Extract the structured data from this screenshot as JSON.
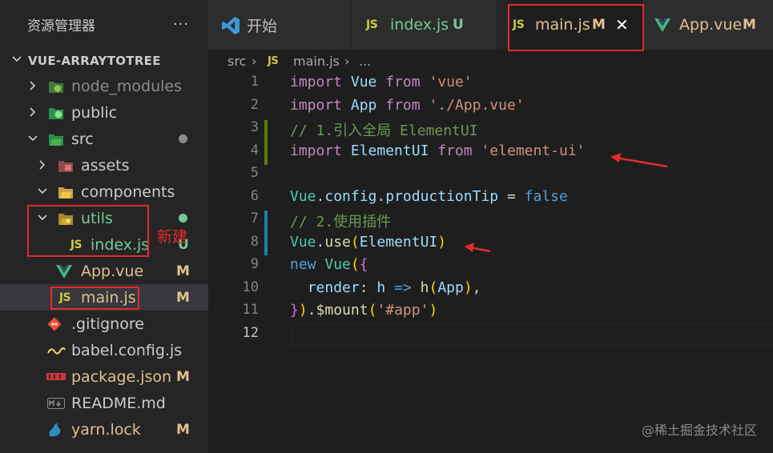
{
  "explorer": {
    "title": "资源管理器",
    "more": "···",
    "project": "VUE-ARRAYTOTREE",
    "items": [
      {
        "label": "node_modules",
        "icon": "node-folder-icon"
      },
      {
        "label": "public",
        "icon": "public-folder-icon"
      },
      {
        "label": "src",
        "icon": "src-folder-icon"
      },
      {
        "label": "assets",
        "icon": "assets-folder-icon"
      },
      {
        "label": "components",
        "icon": "components-folder-icon"
      },
      {
        "label": "utils",
        "icon": "utils-folder-icon"
      },
      {
        "label": "index.js",
        "icon": "js-file-icon",
        "status": "U"
      },
      {
        "label": "App.vue",
        "icon": "vue-file-icon",
        "status": "M"
      },
      {
        "label": "main.js",
        "icon": "js-file-icon",
        "status": "M"
      },
      {
        "label": ".gitignore",
        "icon": "git-file-icon"
      },
      {
        "label": "babel.config.js",
        "icon": "babel-file-icon"
      },
      {
        "label": "package.json",
        "icon": "npm-file-icon",
        "status": "M"
      },
      {
        "label": "README.md",
        "icon": "markdown-file-icon"
      },
      {
        "label": "yarn.lock",
        "icon": "yarn-file-icon",
        "status": "M"
      }
    ]
  },
  "tabs": [
    {
      "label": "开始",
      "icon": "vscode-logo-icon"
    },
    {
      "label": "index.js",
      "icon": "js-file-icon",
      "status": "U"
    },
    {
      "label": "main.js",
      "icon": "js-file-icon",
      "status": "M",
      "close": "✕"
    },
    {
      "label": "App.vue",
      "icon": "vue-file-icon",
      "status": "M"
    }
  ],
  "breadcrumb": {
    "folder": "src",
    "sep": "›",
    "file": "main.js",
    "rest": "..."
  },
  "icons": {
    "js": "JS"
  },
  "editor": {
    "line_numbers": [
      "1",
      "2",
      "3",
      "4",
      "5",
      "6",
      "7",
      "8",
      "9",
      "10",
      "11",
      "12"
    ],
    "lines": [
      {
        "parts": [
          {
            "t": "import",
            "c": "k"
          },
          {
            "t": " ",
            "c": "p"
          },
          {
            "t": "Vue",
            "c": "id"
          },
          {
            "t": " ",
            "c": "p"
          },
          {
            "t": "from",
            "c": "k"
          },
          {
            "t": " ",
            "c": "p"
          },
          {
            "t": "'vue'",
            "c": "s"
          }
        ]
      },
      {
        "parts": [
          {
            "t": "import",
            "c": "k"
          },
          {
            "t": " ",
            "c": "p"
          },
          {
            "t": "App",
            "c": "id"
          },
          {
            "t": " ",
            "c": "p"
          },
          {
            "t": "from",
            "c": "k"
          },
          {
            "t": " ",
            "c": "p"
          },
          {
            "t": "'./App.vue'",
            "c": "s"
          }
        ]
      },
      {
        "parts": [
          {
            "t": "// 1.引入全局 ElementUI",
            "c": "c"
          }
        ]
      },
      {
        "parts": [
          {
            "t": "import",
            "c": "k"
          },
          {
            "t": " ",
            "c": "p"
          },
          {
            "t": "ElementUI",
            "c": "id"
          },
          {
            "t": " ",
            "c": "p"
          },
          {
            "t": "from",
            "c": "k"
          },
          {
            "t": " ",
            "c": "p"
          },
          {
            "t": "'element-ui'",
            "c": "s"
          }
        ]
      },
      {
        "parts": []
      },
      {
        "parts": [
          {
            "t": "Vue",
            "c": "cls"
          },
          {
            "t": ".",
            "c": "p"
          },
          {
            "t": "config",
            "c": "id"
          },
          {
            "t": ".",
            "c": "p"
          },
          {
            "t": "productionTip",
            "c": "id"
          },
          {
            "t": " = ",
            "c": "p"
          },
          {
            "t": "false",
            "c": "b"
          }
        ]
      },
      {
        "parts": [
          {
            "t": "// 2.使用插件",
            "c": "c"
          }
        ]
      },
      {
        "parts": [
          {
            "t": "Vue",
            "c": "cls"
          },
          {
            "t": ".",
            "c": "p"
          },
          {
            "t": "use",
            "c": "fn"
          },
          {
            "t": "(",
            "c": "br1"
          },
          {
            "t": "ElementUI",
            "c": "id"
          },
          {
            "t": ")",
            "c": "br1"
          }
        ]
      },
      {
        "parts": [
          {
            "t": "new",
            "c": "b"
          },
          {
            "t": " ",
            "c": "p"
          },
          {
            "t": "Vue",
            "c": "cls"
          },
          {
            "t": "(",
            "c": "br1"
          },
          {
            "t": "{",
            "c": "br2"
          }
        ]
      },
      {
        "parts": [
          {
            "t": "  ",
            "c": "p"
          },
          {
            "t": "render",
            "c": "id"
          },
          {
            "t": ": ",
            "c": "p"
          },
          {
            "t": "h",
            "c": "id"
          },
          {
            "t": " ",
            "c": "p"
          },
          {
            "t": "=>",
            "c": "b"
          },
          {
            "t": " ",
            "c": "p"
          },
          {
            "t": "h",
            "c": "fn"
          },
          {
            "t": "(",
            "c": "br1"
          },
          {
            "t": "App",
            "c": "id"
          },
          {
            "t": ")",
            "c": "br1"
          },
          {
            "t": ",",
            "c": "p"
          }
        ]
      },
      {
        "parts": [
          {
            "t": "}",
            "c": "br2"
          },
          {
            "t": ")",
            "c": "br1"
          },
          {
            "t": ".",
            "c": "p"
          },
          {
            "t": "$mount",
            "c": "fn"
          },
          {
            "t": "(",
            "c": "br1"
          },
          {
            "t": "'#app'",
            "c": "s"
          },
          {
            "t": ")",
            "c": "br1"
          }
        ]
      },
      {
        "parts": []
      }
    ]
  },
  "annotations": {
    "new_label": "新建"
  },
  "watermark": "@稀土掘金技术社区",
  "colors": {
    "annotation_red": "#e32b2b",
    "modified": "#e2c08d",
    "untracked": "#73c991"
  }
}
